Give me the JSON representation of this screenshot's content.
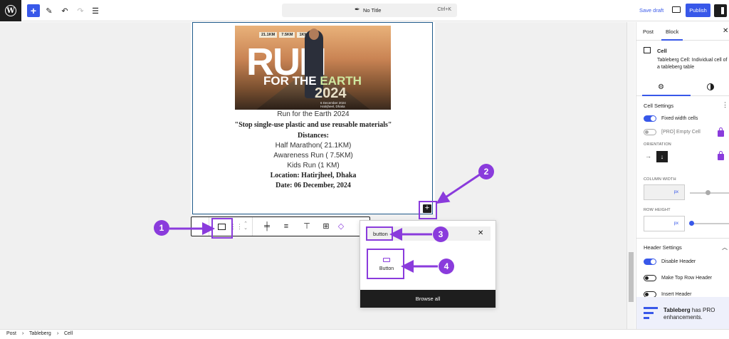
{
  "topbar": {
    "title": "No Title",
    "shortcut": "Ctrl+K",
    "save_draft": "Save draft",
    "publish": "Publish",
    "add_symbol": "+"
  },
  "content": {
    "poster": {
      "distances": [
        "21.1KM",
        "7.5KM",
        "1KM"
      ],
      "run": "RUN",
      "for_the": "FOR THE ",
      "earth": "EARTH",
      "year": "2024",
      "date_small": "6 December 2024",
      "place_small": "Hatirjheel, Dhaka"
    },
    "lines": [
      "Run for the Earth 2024",
      "\"Stop single-use plastic and use reusable materials\"",
      "Distances:",
      "Half Marathon( 21.1KM)",
      "Awareness Run ( 7.5KM)",
      "Kids Run (1 KM)",
      "Location: Hatirjheel, Dhaka",
      "Date: 06 December, 2024"
    ]
  },
  "inserter": {
    "search_value": "button",
    "result_label": "Button",
    "browse_all": "Browse all"
  },
  "callouts": [
    "1",
    "2",
    "3",
    "4"
  ],
  "sidebar": {
    "tabs": [
      "Post",
      "Block"
    ],
    "block_title": "Cell",
    "block_desc": "Tableberg Cell: Individual cell of a tableberg table",
    "cell_settings": "Cell Settings",
    "fixed_width": "Fixed width cells",
    "empty_cell": "[PRO] Empty Cell",
    "orientation": "ORIENTATION",
    "column_width": "COLUMN WIDTH",
    "row_height": "ROW HEIGHT",
    "unit": "px",
    "header_settings": "Header Settings",
    "disable_header": "Disable Header",
    "make_top_row": "Make Top Row Header",
    "insert_header": "Insert Header",
    "promo_brand": "Tableberg",
    "promo_rest": " has PRO",
    "promo_line2": "enhancements."
  },
  "breadcrumb": [
    "Post",
    "Tableberg",
    "Cell"
  ],
  "colors": {
    "accent": "#3858e9",
    "callout": "#8a3bdc"
  }
}
